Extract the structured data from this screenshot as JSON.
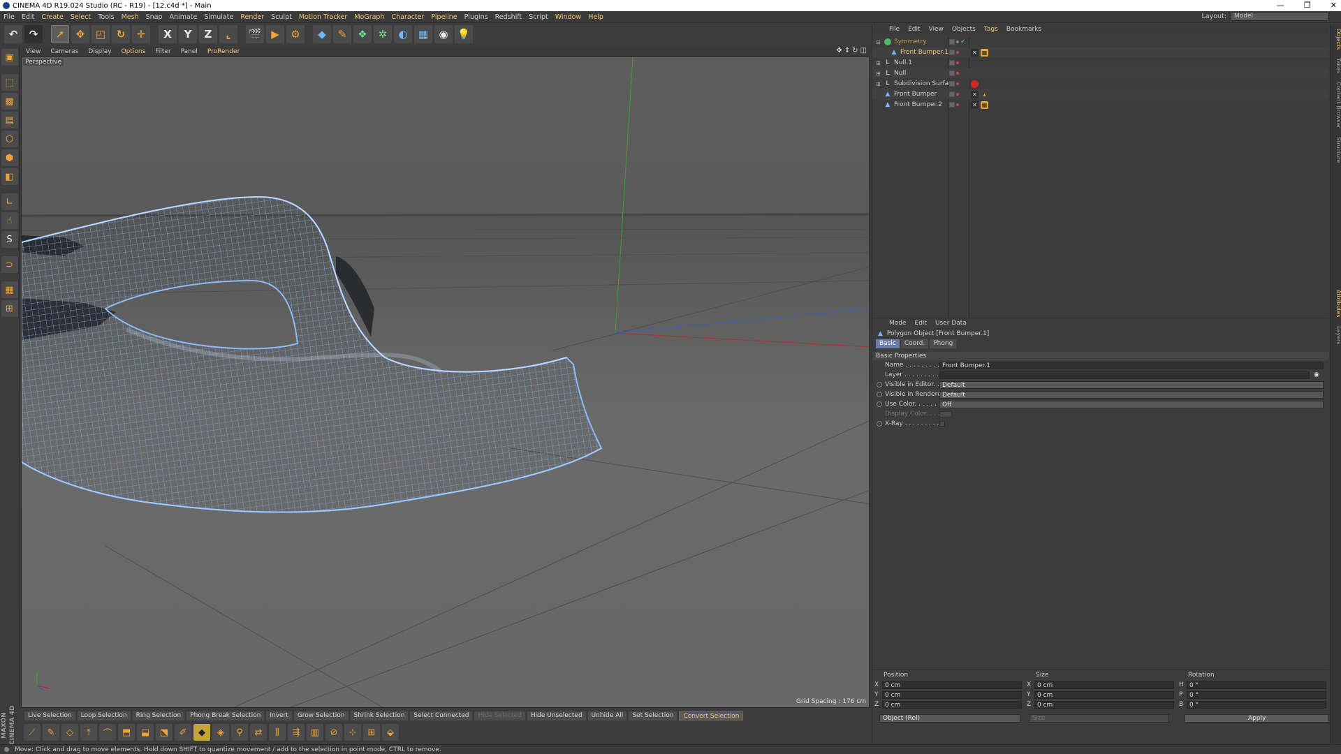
{
  "window": {
    "title": "CINEMA 4D R19.024 Studio (RC - R19) - [12.c4d *] - Main",
    "controls": [
      "—",
      "❐",
      "✕"
    ]
  },
  "menubar": {
    "items": [
      "File",
      "Edit",
      "Create",
      "Select",
      "Tools",
      "Mesh",
      "Snap",
      "Animate",
      "Simulate",
      "Render",
      "Sculpt",
      "Motion Tracker",
      "MoGraph",
      "Character",
      "Pipeline",
      "Plugins",
      "Redshift",
      "Script",
      "Window",
      "Help"
    ],
    "layout_label": "Layout:",
    "layout_value": "Model"
  },
  "toolbar": {
    "axis_x": "X",
    "axis_y": "Y",
    "axis_z": "Z"
  },
  "viewport": {
    "menu": [
      "View",
      "Cameras",
      "Display",
      "Options",
      "Filter",
      "Panel",
      "ProRender"
    ],
    "label": "Perspective",
    "grid_spacing": "Grid Spacing : 176 cm"
  },
  "selection_bar": {
    "items": [
      "Live Selection",
      "Loop Selection",
      "Ring Selection",
      "Phong Break Selection",
      "Invert",
      "Grow Selection",
      "Shrink Selection",
      "Select Connected",
      "Hide Selected",
      "Hide Unselected",
      "Unhide All",
      "Set Selection",
      "Convert Selection"
    ]
  },
  "brand": {
    "line1": "MAXON",
    "line2": "CINEMA 4D"
  },
  "status": {
    "text": "Move: Click and drag to move elements. Hold down SHIFT to quantize movement / add to the selection in point mode, CTRL to remove."
  },
  "object_manager": {
    "menu": [
      "File",
      "Edit",
      "View",
      "Objects",
      "Tags",
      "Bookmarks"
    ],
    "objects": [
      {
        "name": "Symmetry",
        "icon": "symmetry-icon"
      },
      {
        "name": "Front Bumper.1",
        "icon": "polygon-icon"
      },
      {
        "name": "Null.1",
        "icon": "null-icon"
      },
      {
        "name": "Null",
        "icon": "null-icon"
      },
      {
        "name": "Subdivision Surface",
        "icon": "subdivision-icon"
      },
      {
        "name": "Front Bumper",
        "icon": "polygon-icon"
      },
      {
        "name": "Front Bumper.2",
        "icon": "polygon-icon"
      }
    ]
  },
  "attributes": {
    "menu": [
      "Mode",
      "Edit",
      "User Data"
    ],
    "title": "Polygon Object [Front Bumper.1]",
    "tabs": [
      "Basic",
      "Coord.",
      "Phong"
    ],
    "section": "Basic Properties",
    "name_label": "Name . . . . . . . . . . . .",
    "name_value": "Front Bumper.1",
    "layer_label": "Layer . . . . . . . . . . . .",
    "visible_editor_label": "Visible in Editor. . .",
    "visible_editor_value": "Default",
    "visible_renderer_label": "Visible in Renderer",
    "visible_renderer_value": "Default",
    "use_color_label": "Use Color. . . . . . . .",
    "use_color_value": "Off",
    "display_color_label": "Display Color. . . . .",
    "xray_label": "X-Ray . . . . . . . . . . ."
  },
  "coordinates": {
    "headers": [
      "Position",
      "Size",
      "Rotation"
    ],
    "rows": [
      {
        "pos_axis": "X",
        "pos": "0 cm",
        "size_axis": "X",
        "size": "0 cm",
        "rot_axis": "H",
        "rot": "0 °"
      },
      {
        "pos_axis": "Y",
        "pos": "0 cm",
        "size_axis": "Y",
        "size": "0 cm",
        "rot_axis": "P",
        "rot": "0 °"
      },
      {
        "pos_axis": "Z",
        "pos": "0 cm",
        "size_axis": "Z",
        "size": "0 cm",
        "rot_axis": "B",
        "rot": "0 °"
      }
    ],
    "mode": "Object (Rel)",
    "size_mode": "Size",
    "apply": "Apply"
  },
  "side_tabs": [
    "Objects",
    "Takes",
    "Content Browser",
    "Structure"
  ],
  "side_tabs_lower": [
    "Attributes",
    "Layers"
  ]
}
